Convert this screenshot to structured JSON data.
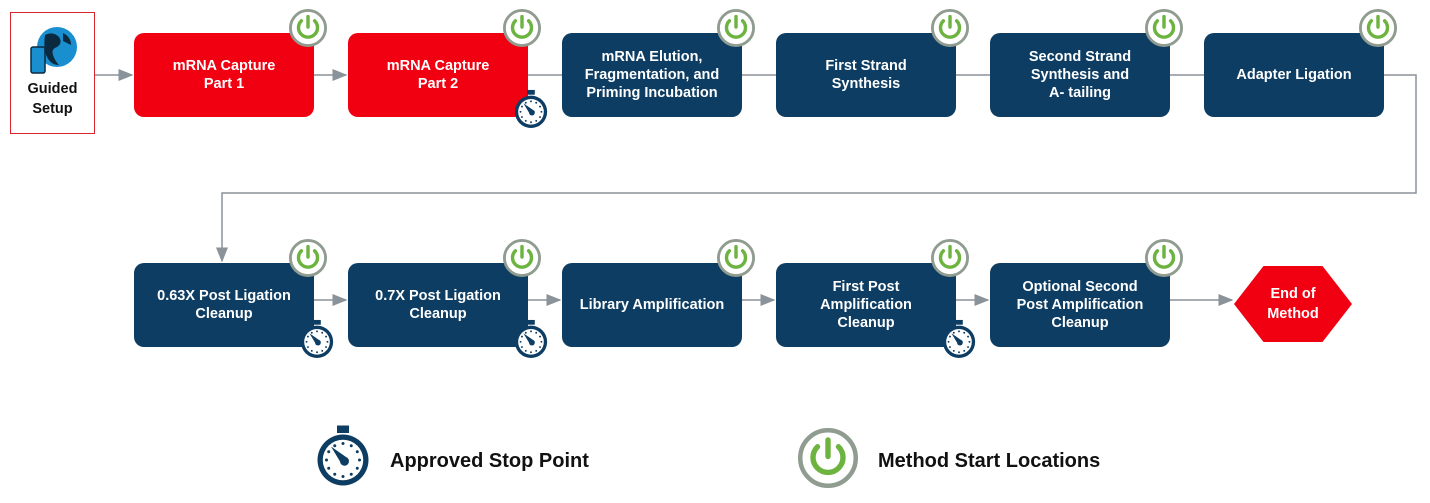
{
  "guided_setup": {
    "label": "Guided\nSetup",
    "icon": "globe-tablet-icon"
  },
  "steps_row1": [
    {
      "label": "mRNA Capture\nPart 1",
      "color": "red",
      "start": true,
      "stop": false
    },
    {
      "label": "mRNA Capture\nPart 2",
      "color": "red",
      "start": true,
      "stop": true
    },
    {
      "label": "mRNA Elution,\nFragmentation, and\nPriming Incubation",
      "color": "navy",
      "start": true,
      "stop": false
    },
    {
      "label": "First Strand\nSynthesis",
      "color": "navy",
      "start": true,
      "stop": false
    },
    {
      "label": "Second Strand\nSynthesis and\nA- tailing",
      "color": "navy",
      "start": true,
      "stop": false
    },
    {
      "label": "Adapter Ligation",
      "color": "navy",
      "start": true,
      "stop": false
    }
  ],
  "steps_row2": [
    {
      "label": "0.63X Post Ligation\nCleanup",
      "color": "navy",
      "start": true,
      "stop": true
    },
    {
      "label": "0.7X Post Ligation\nCleanup",
      "color": "navy",
      "start": true,
      "stop": true
    },
    {
      "label": "Library Amplification",
      "color": "navy",
      "start": true,
      "stop": false
    },
    {
      "label": "First Post\nAmplification\nCleanup",
      "color": "navy",
      "start": true,
      "stop": true
    },
    {
      "label": "Optional Second\nPost Amplification\nCleanup",
      "color": "navy",
      "start": true,
      "stop": false
    }
  ],
  "end": {
    "label": "End of\nMethod"
  },
  "legend": {
    "stop_point": {
      "label": "Approved Stop Point",
      "icon": "stopwatch-icon"
    },
    "start_location": {
      "label": "Method Start Locations",
      "icon": "power-icon"
    }
  },
  "colors": {
    "red": "#f00010",
    "navy": "#0e3d63",
    "power_green": "#6cb33f",
    "power_ring": "#8f9c8f",
    "arrow": "#8a929a"
  }
}
